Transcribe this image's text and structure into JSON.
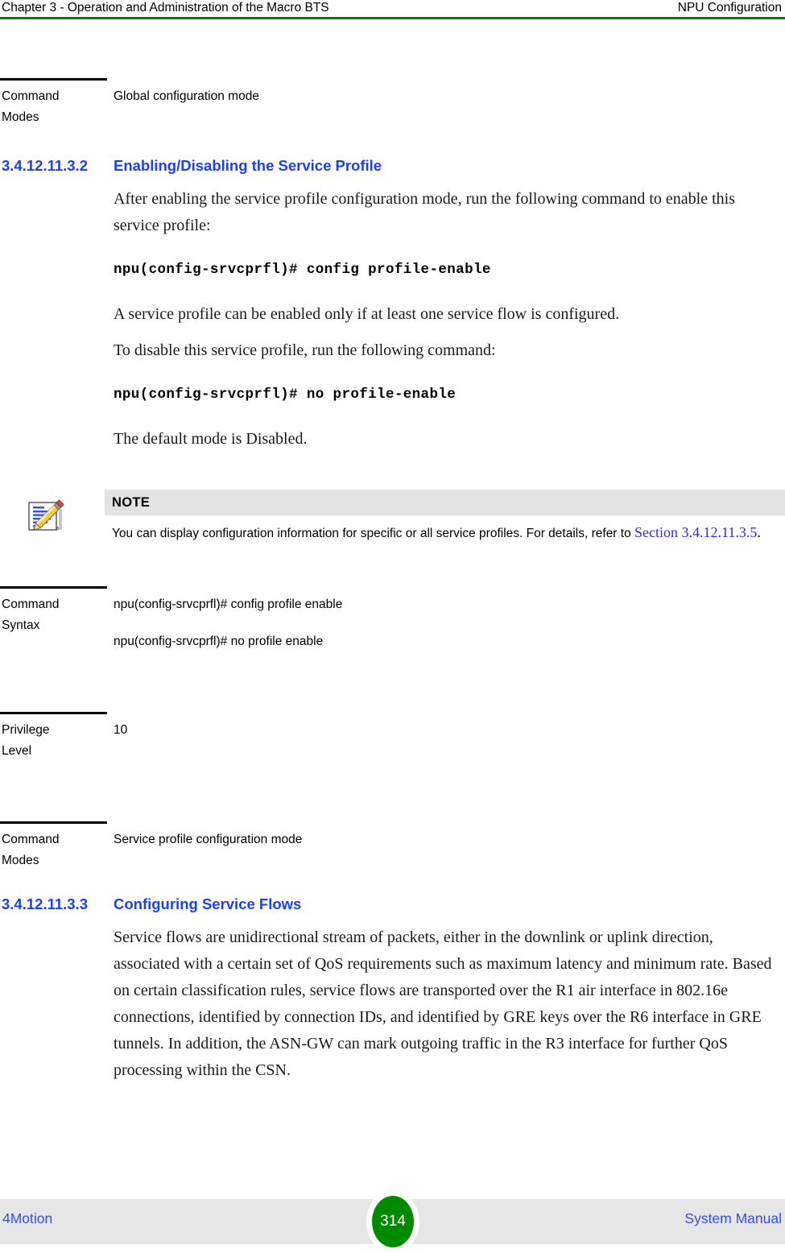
{
  "header": {
    "left": "Chapter 3 - Operation and Administration of the Macro BTS",
    "right": "NPU Configuration",
    "rule_color": "#008000"
  },
  "top_table": {
    "label": "Command Modes",
    "label_line1": "Command",
    "label_line2": "Modes",
    "value": "Global configuration mode"
  },
  "section_enable": {
    "number": "3.4.12.11.3.2",
    "title": "Enabling/Disabling the Service Profile",
    "heading_color": "#1c3ff0",
    "paragraphs": {
      "intro": "After enabling the service profile configuration mode, run the following command to enable this service profile:",
      "code_enable": "npu(config-srvcprfl)# config profile-enable",
      "note_min_flow": "A service profile can be enabled only if at least one service flow is configured.",
      "disable_intro": "To disable this service profile, run the following command:",
      "code_disable": "npu(config-srvcprfl)# no profile-enable",
      "default_mode": "The default mode is Disabled."
    }
  },
  "note": {
    "icon": "note-pencil-icon",
    "title": "NOTE",
    "text": "You can display configuration information for specific or all service profiles. For details, refer to ",
    "link": "Section 3.4.12.11.3.5",
    "trailing": ".",
    "link_color": "#2b2bf0",
    "bar_color": "#e3e3e3"
  },
  "command_syntax": {
    "label_line1": "Command",
    "label_line2": "Syntax",
    "values": [
      "npu(config-srvcprfl)# config profile enable",
      "npu(config-srvcprfl)# no profile enable"
    ]
  },
  "privilege_level": {
    "label_line1": "Privilege",
    "label_line2": "Level",
    "value": "10"
  },
  "command_modes": {
    "label_line1": "Command",
    "label_line2": "Modes",
    "value": "Service profile configuration mode"
  },
  "section_flows": {
    "number": "3.4.12.11.3.3",
    "title": "Configuring Service Flows",
    "paragraph": "Service flows are unidirectional stream of packets, either in the downlink or uplink direction, associated with a certain set of QoS requirements such as maximum latency and minimum rate. Based on certain classification rules, service flows are transported over the R1 air interface in 802.16e connections, identified by connection IDs, and identified by GRE keys over the R6 interface in GRE tunnels. In addition, the ASN-GW can mark outgoing traffic in the R3 interface for further QoS processing within the CSN."
  },
  "footer": {
    "left": "4Motion",
    "page_number": "314",
    "right": "System Manual",
    "badge_color": "#008a00",
    "band_color": "#e6e6e6",
    "text_color": "#2b4ff5"
  }
}
